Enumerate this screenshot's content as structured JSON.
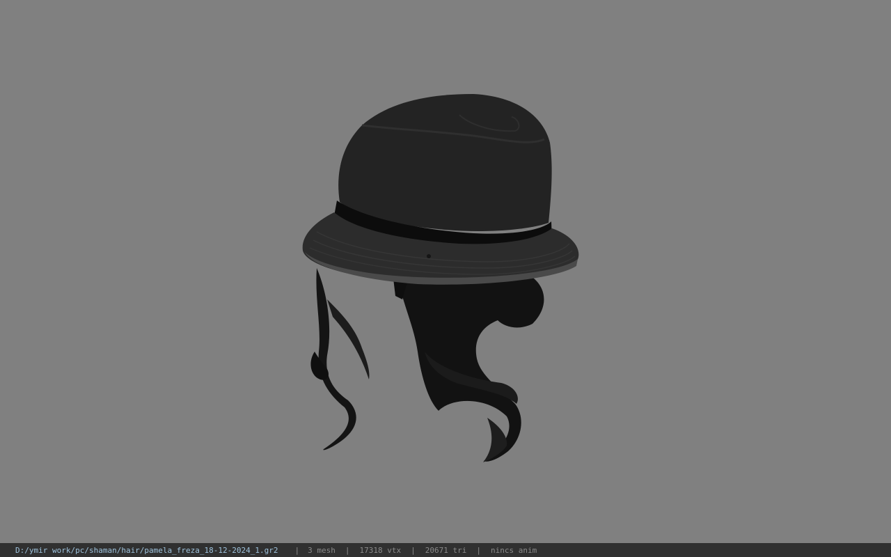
{
  "viewport": {
    "background": "#808080",
    "model": "bucket-hat-with-long-hair"
  },
  "status_bar": {
    "file_path": "D:/ymir work/pc/shaman/hair/pamela_freza_18-12-2024_1.gr2",
    "separator": "|",
    "mesh": "3 mesh",
    "vertices": "17318 vtx",
    "triangles": "20671 tri",
    "animation": "nincs anim",
    "path_color": "#9fc3dd"
  }
}
